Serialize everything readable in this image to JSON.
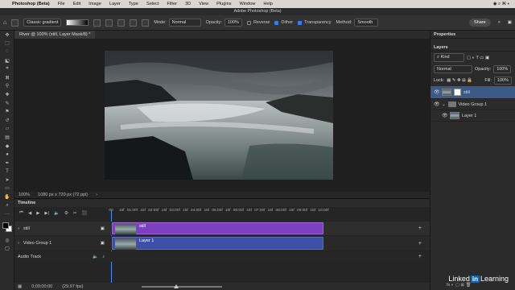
{
  "menubar": {
    "apple": "",
    "app": "Photoshop (Beta)",
    "items": [
      "File",
      "Edit",
      "Image",
      "Layer",
      "Type",
      "Select",
      "Filter",
      "3D",
      "View",
      "Plugins",
      "Window",
      "Help"
    ]
  },
  "window": {
    "title": "Adobe Photoshop (Beta)"
  },
  "options": {
    "preset": "Classic gradient",
    "mode_label": "Mode:",
    "mode_value": "Normal",
    "opacity_label": "Opacity:",
    "opacity_value": "100%",
    "reverse": "Reverse",
    "dither": "Dither",
    "transparency": "Transparency",
    "method_label": "Method:",
    "method_value": "Smooth",
    "share": "Share"
  },
  "document": {
    "tab": "River @ 100% (still, Layer Mask/8) *",
    "zoom": "100%",
    "info": "1080 px x 720 px (72 ppi)"
  },
  "timeline": {
    "title": "Timeline",
    "ruler": [
      "00",
      "15f",
      "01:00f",
      "15f",
      "02:00f",
      "15f",
      "03:00f",
      "15f",
      "04:00f",
      "15f",
      "05:00f",
      "15f",
      "06:00f",
      "15f",
      "07:00f",
      "15f",
      "08:00f",
      "15f",
      "09:00f",
      "15f",
      "10:00f"
    ],
    "tracks": [
      {
        "name": "still",
        "clip": "still"
      },
      {
        "name": "Video Group 1",
        "clip": "Layer 1"
      },
      {
        "name": "Audio Track"
      }
    ],
    "timecode": "0;00;00;00",
    "fps": "(29.97 fps)"
  },
  "panels": {
    "properties": "Properties",
    "layers": "Layers",
    "kind": "Kind",
    "blend": "Normal",
    "opacity_label": "Opacity:",
    "opacity_value": "100%",
    "lock_label": "Lock:",
    "fill_label": "Fill:",
    "fill_value": "100%",
    "layers_list": [
      {
        "name": "still"
      },
      {
        "name": "Video Group 1"
      },
      {
        "name": "Layer 1"
      }
    ]
  },
  "watermark": {
    "text1": "Linked",
    "text2": "in",
    "text3": "Learning"
  },
  "colors": {
    "clip_purple": "#7b3fbf",
    "clip_blue": "#3d4fa6",
    "accent": "#2d7ff9"
  }
}
